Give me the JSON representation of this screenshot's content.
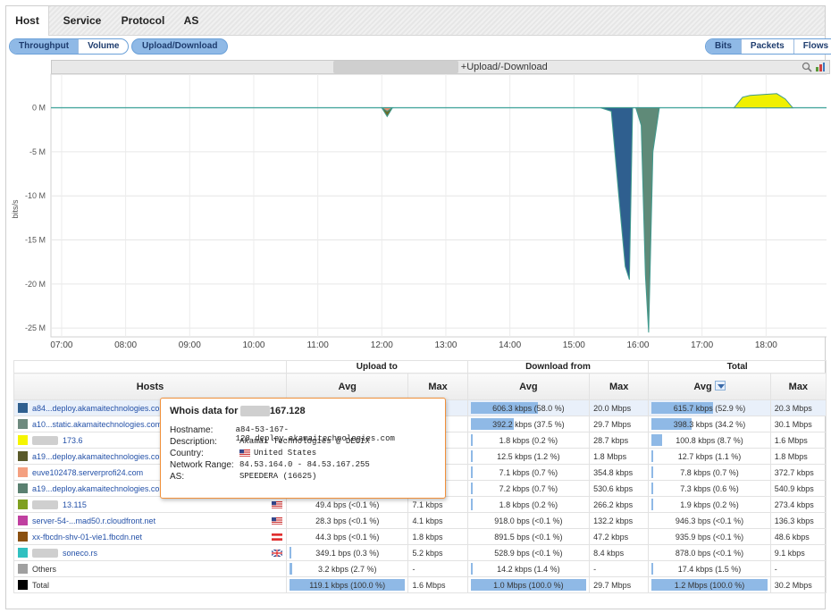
{
  "tabs": [
    "Host",
    "Service",
    "Protocol",
    "AS"
  ],
  "metric_toggle": [
    "Throughput",
    "Volume"
  ],
  "direction_button": "Upload/Download",
  "unit_toggle": [
    "Bits",
    "Packets",
    "Flows"
  ],
  "chart": {
    "title_suffix": "+Upload/-Download",
    "ylabel": "bits/s",
    "y_ticks": [
      "0 M",
      "-5 M",
      "-10 M",
      "-15 M",
      "-20 M",
      "-25 M"
    ],
    "x_ticks": [
      "07:00",
      "08:00",
      "09:00",
      "10:00",
      "11:00",
      "12:00",
      "13:00",
      "14:00",
      "15:00",
      "16:00",
      "17:00",
      "18:00"
    ]
  },
  "chart_data": {
    "type": "area",
    "ylabel": "bits/s",
    "ylim": [
      -26000000,
      3000000
    ],
    "x_range": [
      "06:50",
      "19:00"
    ],
    "grid": true,
    "series": [
      {
        "name": "a84...deploy.akamaitechnologies.com",
        "color": "#2f5f8f",
        "x": [
          "15:25",
          "15:35",
          "15:42",
          "15:48",
          "15:52",
          "15:55"
        ],
        "y": [
          0,
          -400000,
          -10000000,
          -18000000,
          -19500000,
          0
        ]
      },
      {
        "name": "a10...static.akamaitechnologies.com",
        "color": "#5f8a78",
        "x": [
          "15:58",
          "16:03",
          "16:07",
          "16:10",
          "16:14",
          "16:20"
        ],
        "y": [
          0,
          -2000000,
          -19000000,
          -25500000,
          -5000000,
          0
        ]
      },
      {
        "name": "173.6",
        "color": "#f0f000",
        "x": [
          "17:30",
          "17:38",
          "17:45",
          "18:10",
          "18:18",
          "18:25"
        ],
        "y": [
          0,
          1200000,
          1400000,
          1600000,
          1000000,
          0
        ]
      },
      {
        "name": "a19...deploy.akamaitechnologies.com",
        "color": "#6b6b2a",
        "x": [
          "12:00",
          "12:05",
          "12:10"
        ],
        "y": [
          0,
          -1000000,
          0
        ]
      },
      {
        "name": "euve102478.serverprofi24.com",
        "color": "#f09070",
        "x": [
          "12:00",
          "12:05",
          "12:10"
        ],
        "y": [
          0,
          -400000,
          0
        ]
      }
    ]
  },
  "table": {
    "headers": {
      "hosts": "Hosts",
      "upload": "Upload to",
      "download": "Download from",
      "total": "Total",
      "avg": "Avg",
      "max": "Max"
    },
    "rows": [
      {
        "color": "#2f5f8f",
        "host": "a84...deploy.akamaitechnologies.com",
        "flag": "",
        "up_avg": "",
        "up_max": "s",
        "dn_avg": "606.3 kbps (58.0 %)",
        "dn_max": "20.0 Mbps",
        "tot_avg": "615.7 kbps (52.9 %)",
        "tot_max": "20.3 Mbps",
        "dn_pct": 58.0,
        "tot_pct": 52.9,
        "up_pct": 0
      },
      {
        "color": "#6e8a7e",
        "host": "a10...static.akamaitechnologies.com",
        "flag": "",
        "up_avg": "",
        "up_max": "s",
        "dn_avg": "392.2 kbps (37.5 %)",
        "dn_max": "29.7 Mbps",
        "tot_avg": "398.3 kbps (34.2 %)",
        "tot_max": "30.1 Mbps",
        "dn_pct": 37.5,
        "tot_pct": 34.2,
        "up_pct": 0
      },
      {
        "color": "#f5f500",
        "host": "173.6",
        "flag": "",
        "up_avg": "",
        "up_max": "",
        "dn_avg": "1.8 kbps (0.2 %)",
        "dn_max": "28.7 kbps",
        "tot_avg": "100.8 kbps (8.7 %)",
        "tot_max": "1.6 Mbps",
        "dn_pct": 0.2,
        "tot_pct": 8.7,
        "up_pct": 0
      },
      {
        "color": "#5a5a2a",
        "host": "a19...deploy.akamaitechnologies.com",
        "flag": "",
        "up_avg": "",
        "up_max": "",
        "dn_avg": "12.5 kbps (1.2 %)",
        "dn_max": "1.8 Mbps",
        "tot_avg": "12.7 kbps (1.1 %)",
        "tot_max": "1.8 Mbps",
        "dn_pct": 1.2,
        "tot_pct": 1.1,
        "up_pct": 0
      },
      {
        "color": "#f4a080",
        "host": "euve102478.serverprofi24.com",
        "flag": "",
        "up_avg": "",
        "up_max": "",
        "dn_avg": "7.1 kbps (0.7 %)",
        "dn_max": "354.8 kbps",
        "tot_avg": "7.8 kbps (0.7 %)",
        "tot_max": "372.7 kbps",
        "dn_pct": 0.7,
        "tot_pct": 0.7,
        "up_pct": 0
      },
      {
        "color": "#5a8070",
        "host": "a19...deploy.akamaitechnologies.com",
        "flag": "",
        "up_avg": "",
        "up_max": "",
        "dn_avg": "7.2 kbps (0.7 %)",
        "dn_max": "530.6 kbps",
        "tot_avg": "7.3 kbps (0.6 %)",
        "tot_max": "540.9 kbps",
        "dn_pct": 0.7,
        "tot_pct": 0.6,
        "up_pct": 0
      },
      {
        "color": "#7fa020",
        "host": "13.115",
        "flag": "us",
        "up_avg": "49.4 bps (<0.1 %)",
        "up_max": "7.1 kbps",
        "dn_avg": "1.8 kbps (0.2 %)",
        "dn_max": "266.2 kbps",
        "tot_avg": "1.9 kbps (0.2 %)",
        "tot_max": "273.4 kbps",
        "dn_pct": 0.2,
        "tot_pct": 0.2,
        "up_pct": 0
      },
      {
        "color": "#c040a0",
        "host": "server-54-...mad50.r.cloudfront.net",
        "flag": "us",
        "up_avg": "28.3 bps (<0.1 %)",
        "up_max": "4.1 kbps",
        "dn_avg": "918.0 bps (<0.1 %)",
        "dn_max": "132.2 kbps",
        "tot_avg": "946.3 bps (<0.1 %)",
        "tot_max": "136.3 kbps",
        "dn_pct": 0,
        "tot_pct": 0,
        "up_pct": 0
      },
      {
        "color": "#8a5010",
        "host": "xx-fbcdn-shv-01-vie1.fbcdn.net",
        "flag": "at",
        "up_avg": "44.3 bps (<0.1 %)",
        "up_max": "1.8 kbps",
        "dn_avg": "891.5 bps (<0.1 %)",
        "dn_max": "47.2 kbps",
        "tot_avg": "935.9 bps (<0.1 %)",
        "tot_max": "48.6 kbps",
        "dn_pct": 0,
        "tot_pct": 0,
        "up_pct": 0
      },
      {
        "color": "#30c0c0",
        "host": "soneco.rs",
        "flag": "gb",
        "up_avg": "349.1 bps (0.3 %)",
        "up_max": "5.2 kbps",
        "dn_avg": "528.9 bps (<0.1 %)",
        "dn_max": "8.4 kbps",
        "tot_avg": "878.0 bps (<0.1 %)",
        "tot_max": "9.1 kbps",
        "dn_pct": 0,
        "tot_pct": 0,
        "up_pct": 0.3
      },
      {
        "color": "#a0a0a0",
        "host": "Others",
        "flag": "",
        "up_avg": "3.2 kbps (2.7 %)",
        "up_max": "-",
        "dn_avg": "14.2 kbps (1.4 %)",
        "dn_max": "-",
        "tot_avg": "17.4 kbps (1.5 %)",
        "tot_max": "-",
        "dn_pct": 1.4,
        "tot_pct": 1.5,
        "up_pct": 2.7
      },
      {
        "color": "#000000",
        "host": "Total",
        "flag": "",
        "up_avg": "119.1 kbps (100.0 %)",
        "up_max": "1.6 Mbps",
        "dn_avg": "1.0 Mbps (100.0 %)",
        "dn_max": "29.7 Mbps",
        "tot_avg": "1.2 Mbps (100.0 %)",
        "tot_max": "30.2 Mbps",
        "dn_pct": 100,
        "tot_pct": 100,
        "up_pct": 100
      }
    ]
  },
  "whois": {
    "title_prefix": "Whois data for",
    "title_ip": "167.128",
    "fields": [
      {
        "label": "Hostname:",
        "value": "a84-53-167-128.deploy.akamaitechnologies.com"
      },
      {
        "label": "Description:",
        "value": "Akamai Technologies @ DECIX"
      },
      {
        "label": "Country:",
        "value": "United States"
      },
      {
        "label": "Network Range:",
        "value": "84.53.164.0 - 84.53.167.255"
      },
      {
        "label": "AS:",
        "value": "SPEEDERA (16625)"
      }
    ]
  }
}
